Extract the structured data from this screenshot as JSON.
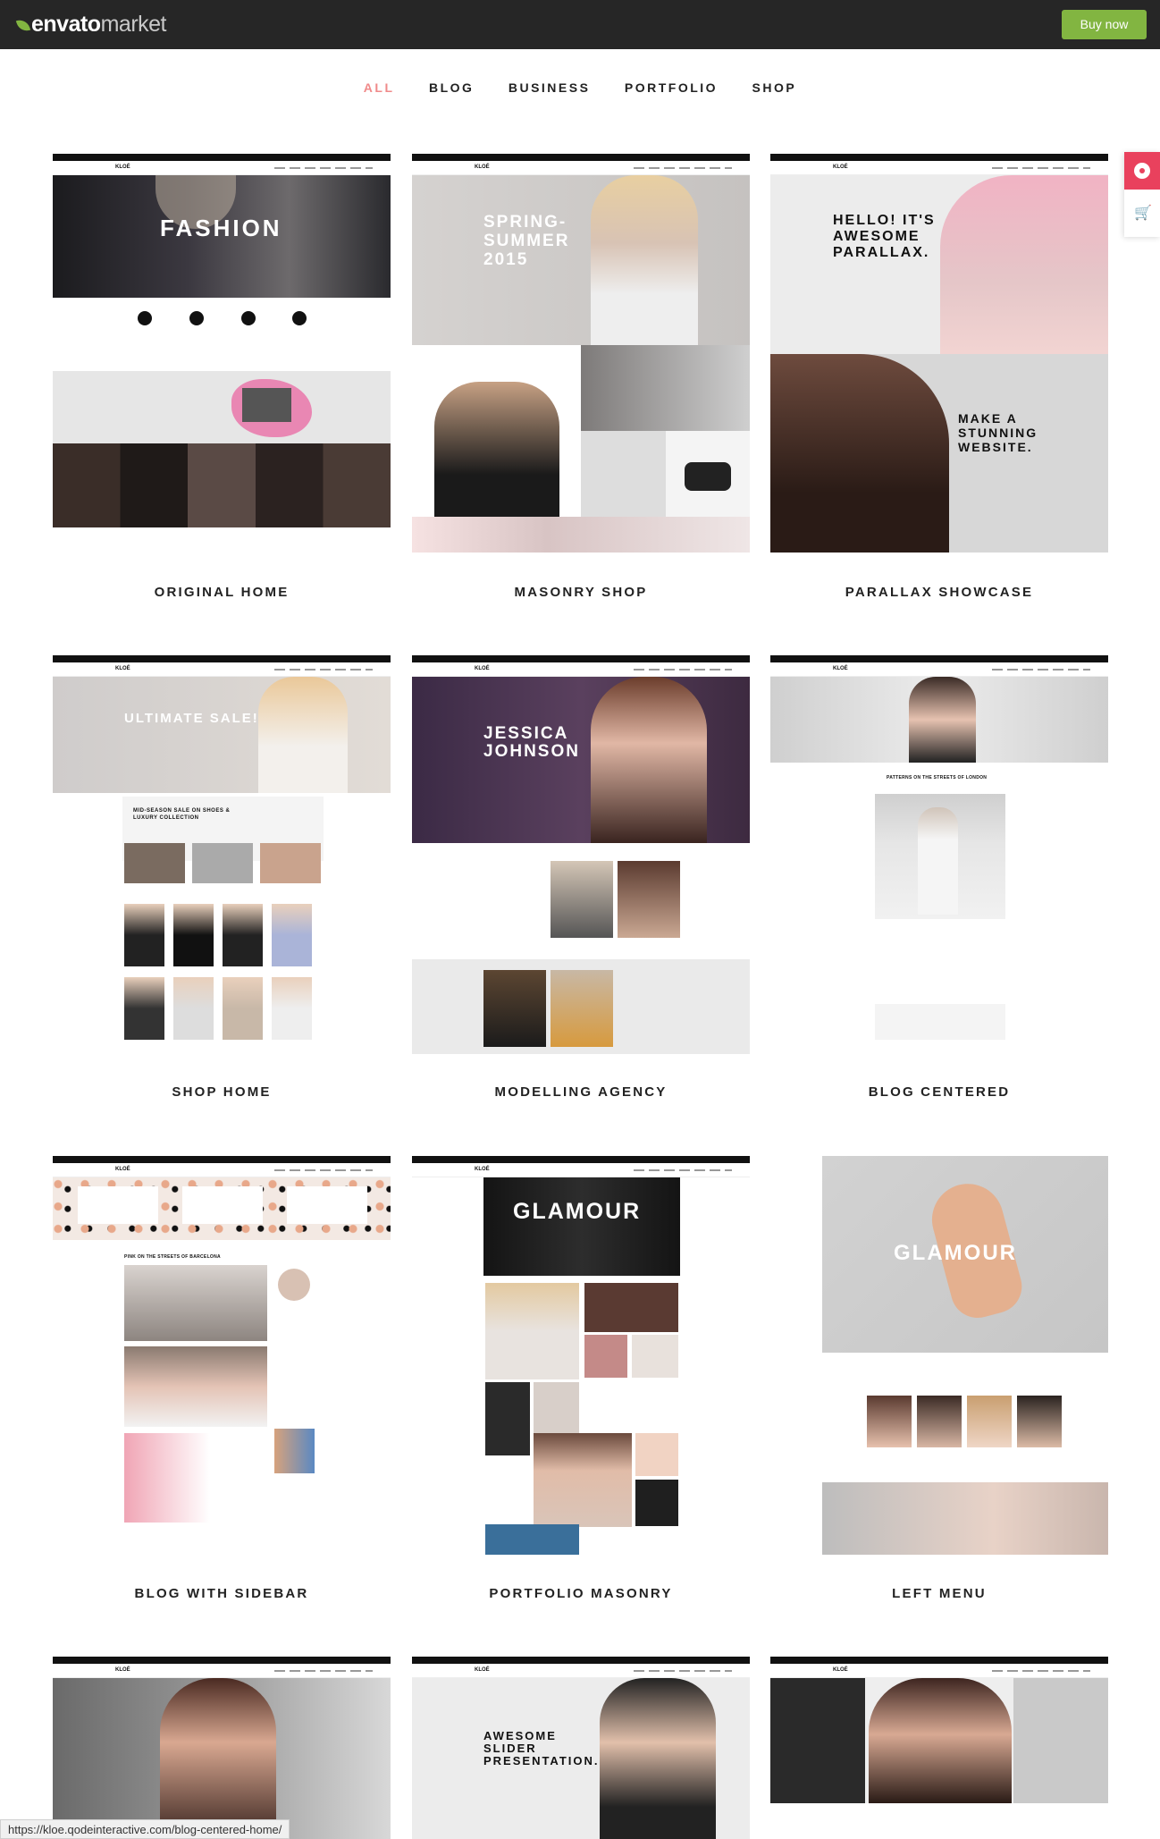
{
  "header": {
    "logo_text_bold": "envato",
    "logo_text_light": "market",
    "buy_label": "Buy now"
  },
  "filters": [
    "ALL",
    "BLOG",
    "BUSINESS",
    "PORTFOLIO",
    "SHOP"
  ],
  "active_filter": "ALL",
  "demos": [
    {
      "caption": "ORIGINAL HOME",
      "hero": "FASHION"
    },
    {
      "caption": "MASONRY SHOP",
      "hero": "SPRING-SUMMER 2015"
    },
    {
      "caption": "PARALLAX SHOWCASE",
      "hero": "HELLO! IT'S AWESOME PARALLAX."
    },
    {
      "caption": "SHOP HOME",
      "hero": "ULTIMATE SALE!"
    },
    {
      "caption": "MODELLING AGENCY",
      "hero": "JESSICA JOHNSON"
    },
    {
      "caption": "BLOG CENTERED",
      "hero": "PATTERNS ON THE STREETS OF LONDON"
    },
    {
      "caption": "BLOG WITH SIDEBAR",
      "hero": "PINK ON THE STREETS OF BARCELONA"
    },
    {
      "caption": "PORTFOLIO MASONRY",
      "hero": "GLAMOUR"
    },
    {
      "caption": "LEFT MENU",
      "hero": "GLAMOUR"
    },
    {
      "caption": "",
      "hero": ""
    },
    {
      "caption": "",
      "hero": "AWESOME SLIDER PRESENTATION."
    },
    {
      "caption": "",
      "hero": ""
    }
  ],
  "extra_texts": {
    "parallax_second": "MAKE A STUNNING WEBSITE.",
    "shop_second": "MID-SEASON SALE ON SHOES & LUXURY COLLECTION"
  },
  "status_url": "https://kloe.qodeinteractive.com/blog-centered-home/",
  "colors": {
    "accent": "#f08a8a",
    "buy": "#82b541",
    "widget": "#e9415d",
    "topbar": "#262626"
  }
}
